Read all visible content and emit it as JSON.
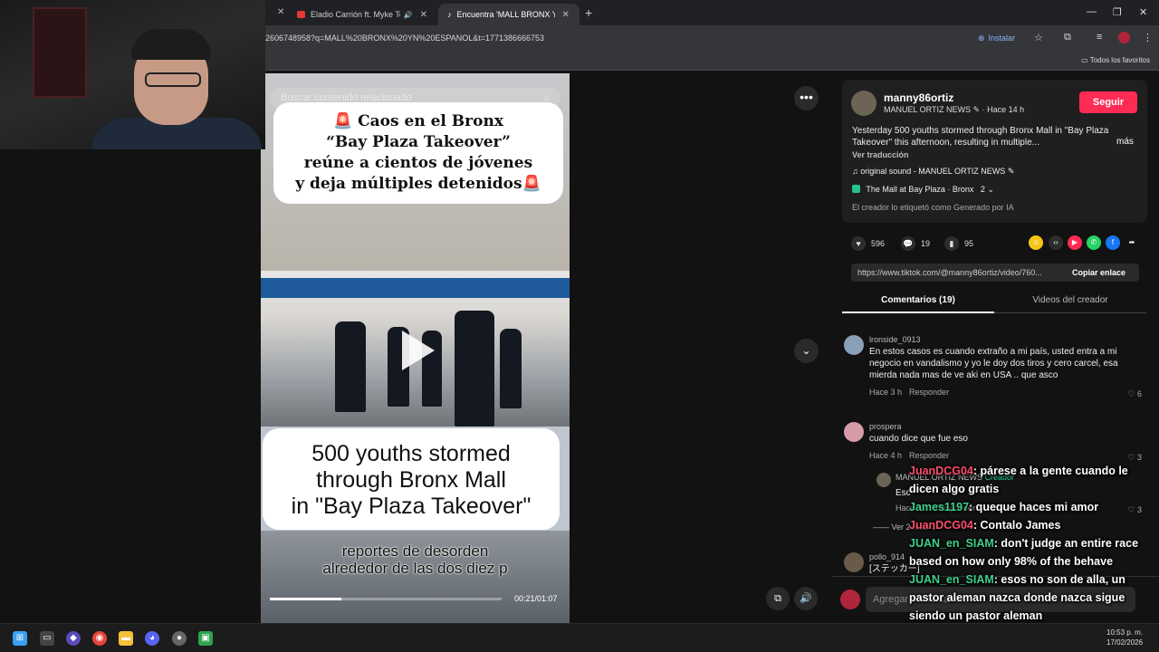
{
  "browser": {
    "tabs": [
      {
        "label": "Eladio Carrión ft. Myke Tow",
        "muted": true
      },
      {
        "label": "Encuentra 'MALL BRONX YN ES"
      }
    ],
    "new_tab": "+",
    "url": "2606748958?q=MALL%20BRONX%20YN%20ESPANOL&t=1771386666753",
    "install_label": "Instalar",
    "favorites_label": "Todos los favoritos"
  },
  "video": {
    "search_placeholder": "Buscar contenido relacionado",
    "headline_lines": [
      "🚨 Caos en el Bronx",
      "“Bay Plaza Takeover”",
      "reúne a cientos de jóvenes",
      "y deja múltiples detenidos🚨"
    ],
    "english_lines": [
      "500 youths stormed",
      "through Bronx Mall",
      "in \"Bay Plaza Takeover\""
    ],
    "caption_lines": [
      "reportes de desorden",
      "alrededor de las dos diez p"
    ],
    "time": "00:21/01:07",
    "progress": 0.31
  },
  "post": {
    "username": "manny86ortiz",
    "display_name": "MANUEL ORTIZ NEWS",
    "posted": "Hace 14 h",
    "follow_label": "Seguir",
    "description": "Yesterday 500 youths stormed through Bronx Mall in \"Bay Plaza Takeover\" this afternoon, resulting in multiple...",
    "more_label": "más",
    "translate_label": "Ver traducción",
    "sound": "original sound - MANUEL ORTIZ NEWS",
    "place": "The Mall at Bay Plaza · Bronx",
    "place_count": "2",
    "ai_label": "El creador lo etiquetó como Generado por IA",
    "likes": "596",
    "comments": "19",
    "saves": "95",
    "link": "https://www.tiktok.com/@manny86ortiz/video/760...",
    "copy_label": "Copiar enlace",
    "tab_comments": "Comentarios (19)",
    "tab_videos": "Videos del creador",
    "comment_placeholder": "Agregar comentario..."
  },
  "comments": [
    {
      "user": "lronside_0913",
      "text": "En estos casos es cuando extraño a mi país, usted entra a mi negocio en vandalismo y yo le doy dos tiros y cero carcel, esa mierda nada mas de ve aki en USA .. que asco",
      "time": "Hace 3 h",
      "reply": "Responder",
      "likes": "6"
    },
    {
      "user": "prospera",
      "text": "cuando dice que fue eso",
      "time": "Hace 4 h",
      "reply": "Responder",
      "likes": "3"
    },
    {
      "user": "MANUEL ORTIZ NEWS",
      "badge": "Creador",
      "text": "Esc",
      "time": "Hace 1 h",
      "reply": "Responder",
      "likes": "3"
    },
    {
      "user": "pollo_914",
      "text": "[ステッカー]"
    }
  ],
  "more_replies": "Ver 2 más",
  "chat": [
    {
      "name": "JuanDCG04",
      "color": "#ff4d6d",
      "text": ": párese a la gente cuando le dicen algo gratis"
    },
    {
      "name": "James1197",
      "color": "#3fd18c",
      "text": ": queque haces mi amor"
    },
    {
      "name": "JuanDCG04",
      "color": "#ff4d6d",
      "text": ": Contalo James"
    },
    {
      "name": "JUAN_en_SIAM",
      "color": "#3fd18c",
      "text": ": don't judge an entire race based on how only 98% of the behave"
    },
    {
      "name": "JUAN_en_SIAM",
      "color": "#3fd18c",
      "text": ": esos no son de alla, un pastor aleman nazca donde nazca sigue siendo un pastor aleman"
    }
  ],
  "clock": {
    "time": "10:53 p. m.",
    "date": "17/02/2026"
  },
  "colors": {
    "accent": "#fe2c55",
    "bg": "#121212",
    "panel": "#1f1f1f"
  }
}
